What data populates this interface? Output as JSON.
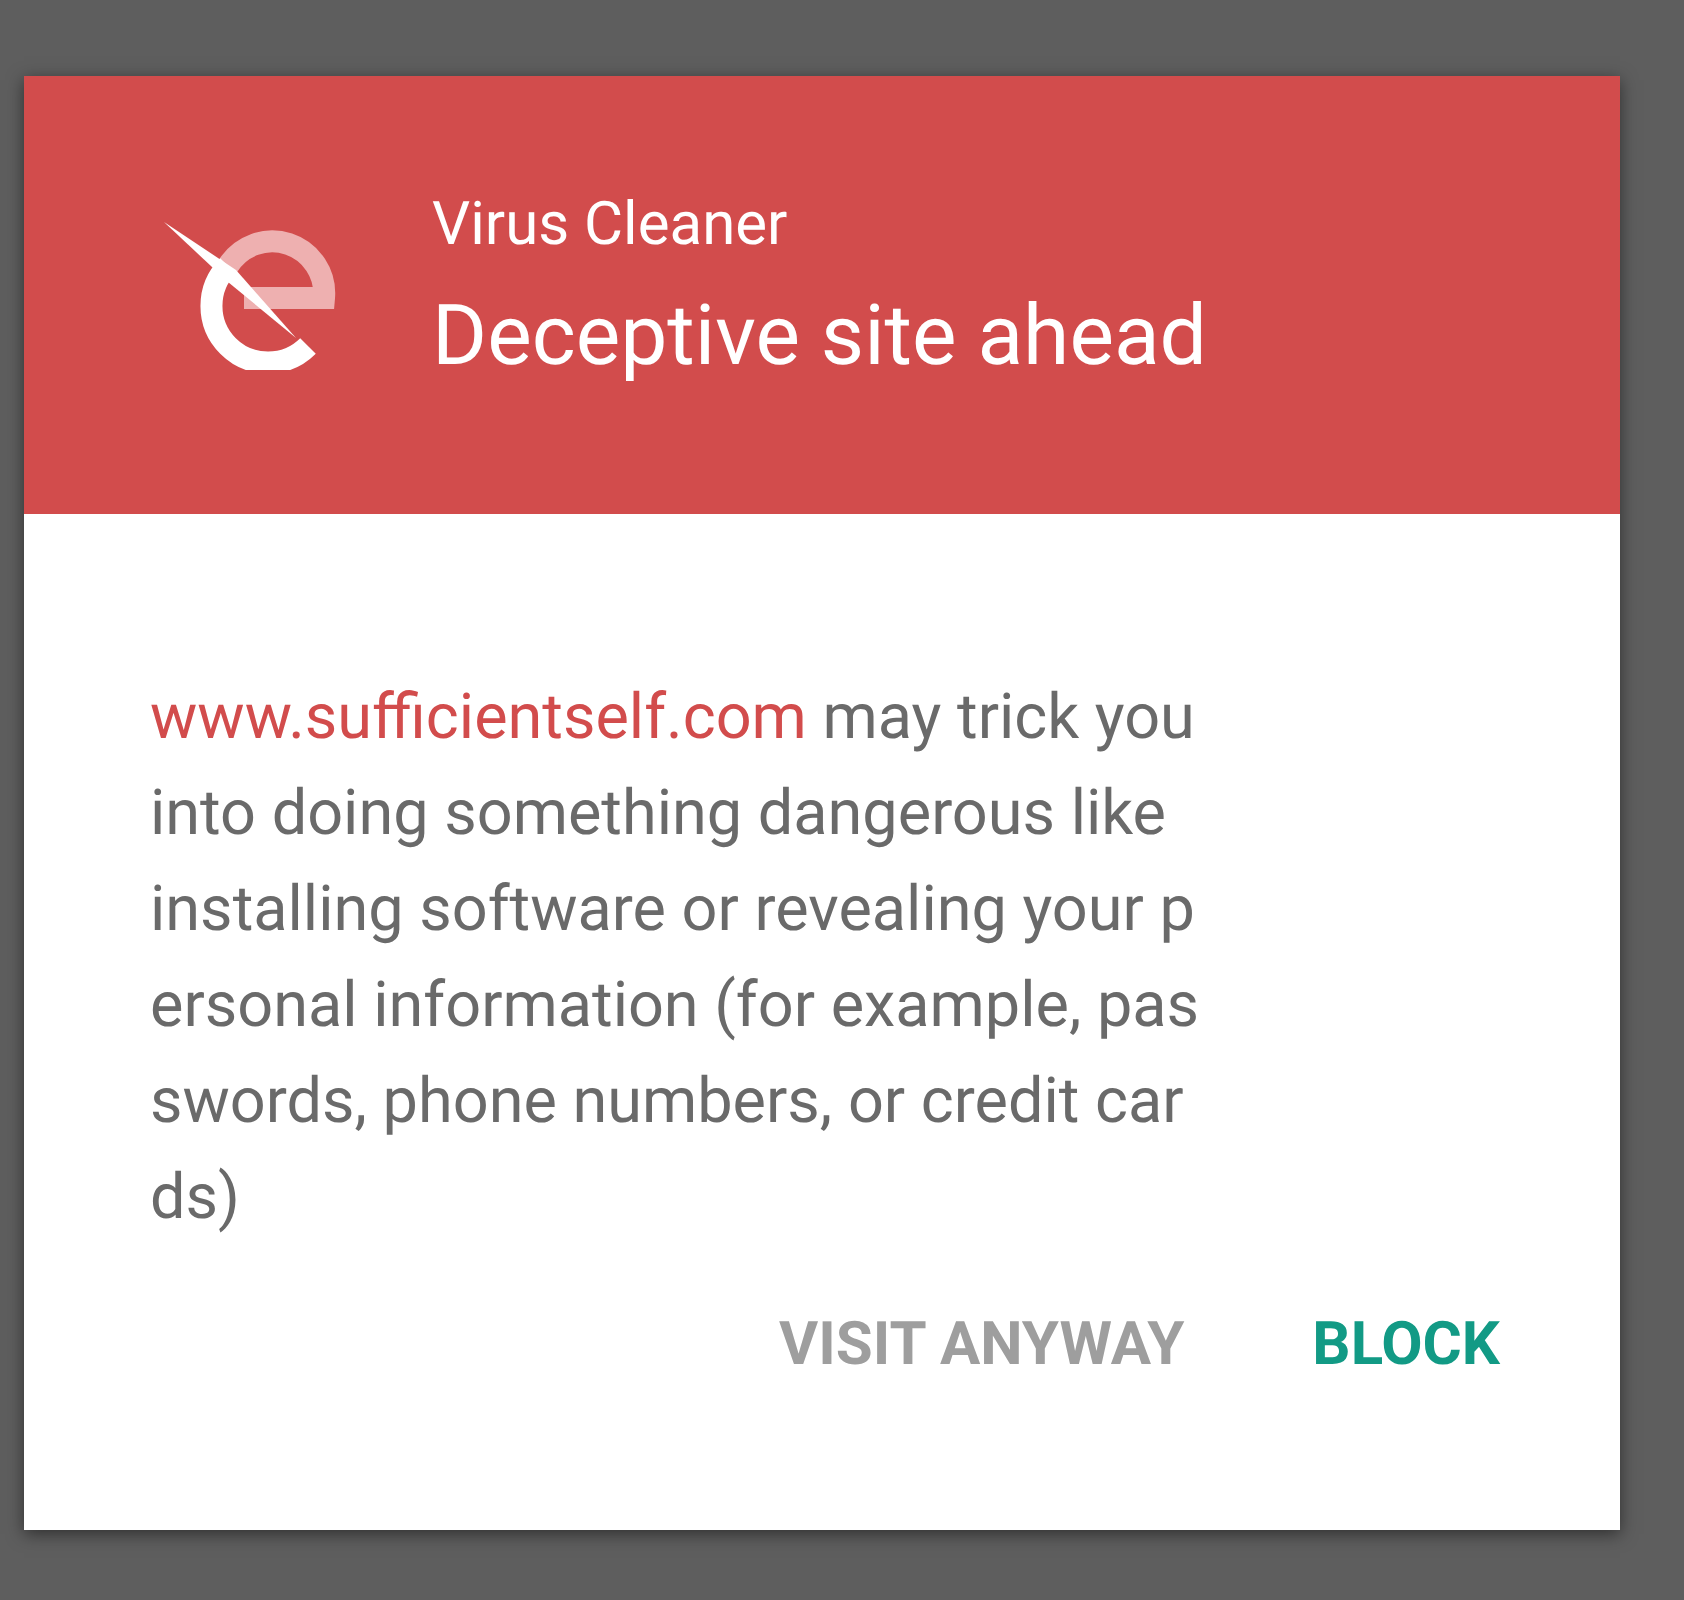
{
  "dialog": {
    "app_name": "Virus Cleaner",
    "title": "Deceptive site ahead",
    "message": {
      "link": "www.sufficientself.com",
      "lines": [
        "may trick you",
        "into doing something dangerous like",
        "installing software or revealing your p",
        "ersonal information (for example, pas",
        "swords, phone numbers, or credit car",
        "ds)"
      ]
    },
    "buttons": [
      {
        "label": "VISIT ANYWAY",
        "kind": "secondary"
      },
      {
        "label": "BLOCK",
        "kind": "primary"
      }
    ]
  }
}
